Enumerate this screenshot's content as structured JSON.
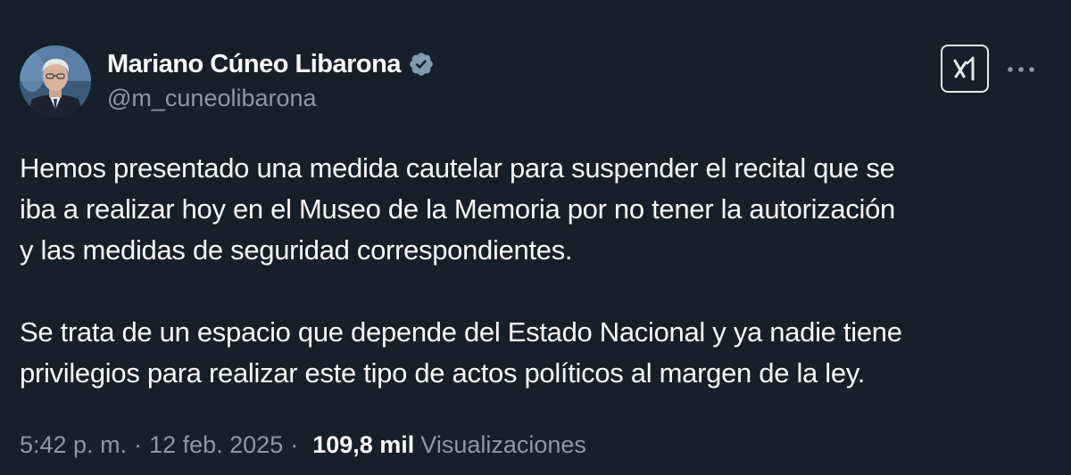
{
  "author": {
    "display_name": "Mariano Cúneo Libarona",
    "handle": "@m_cuneolibarona",
    "verified": true,
    "avatar_icon": "profile-photo"
  },
  "actions": {
    "grok_icon": "grok-icon",
    "more_icon": "more-horizontal-icon"
  },
  "tweet": {
    "paragraphs": [
      "Hemos presentado una medida cautelar para suspender el recital que se\niba a realizar hoy en el Museo de la Memoria por no tener la autorización\ny las medidas de seguridad correspondientes.",
      "Se trata de un espacio que depende del Estado Nacional y ya nadie tiene\nprivilegios para realizar este tipo de actos políticos al margen de la ley."
    ]
  },
  "meta": {
    "time": "5:42 p. m.",
    "separator": "·",
    "date": "12 feb. 2025",
    "views_count": "109,8 mil",
    "views_label": "Visualizaciones"
  },
  "colors": {
    "background": "#15202b",
    "text_primary": "#f7f9f9",
    "text_secondary": "#8b98a5",
    "verified_badge": "#829aab"
  }
}
